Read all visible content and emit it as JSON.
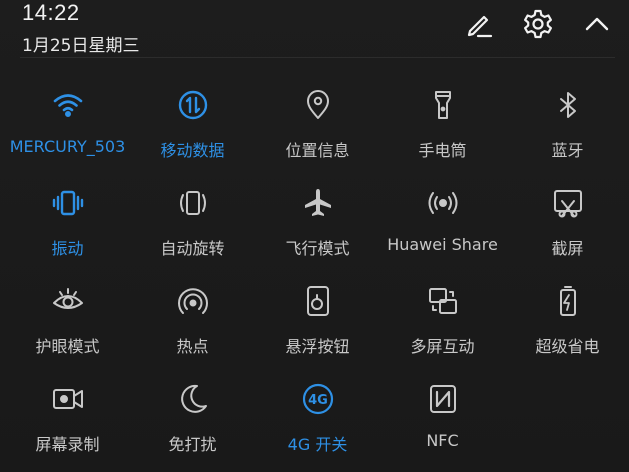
{
  "status": {
    "time": "14:22",
    "date": "1月25日星期三"
  },
  "header_actions": [
    {
      "icon": "edit-icon"
    },
    {
      "icon": "settings-icon"
    },
    {
      "icon": "collapse-icon"
    }
  ],
  "colors": {
    "active": "#2e90e5",
    "inactive": "#c8c8c8",
    "background": "#1b1b1b"
  },
  "toggles": [
    {
      "label": "MERCURY_503",
      "icon": "wifi-icon",
      "active": true
    },
    {
      "label": "移动数据",
      "icon": "mobile-data-icon",
      "active": true
    },
    {
      "label": "位置信息",
      "icon": "location-icon",
      "active": false
    },
    {
      "label": "手电筒",
      "icon": "flashlight-icon",
      "active": false
    },
    {
      "label": "蓝牙",
      "icon": "bluetooth-icon",
      "active": false
    },
    {
      "label": "振动",
      "icon": "vibrate-icon",
      "active": true
    },
    {
      "label": "自动旋转",
      "icon": "auto-rotate-icon",
      "active": false
    },
    {
      "label": "飞行模式",
      "icon": "airplane-icon",
      "active": false
    },
    {
      "label": "Huawei Share",
      "icon": "huawei-share-icon",
      "active": false
    },
    {
      "label": "截屏",
      "icon": "screenshot-icon",
      "active": false
    },
    {
      "label": "护眼模式",
      "icon": "eye-comfort-icon",
      "active": false
    },
    {
      "label": "热点",
      "icon": "hotspot-icon",
      "active": false
    },
    {
      "label": "悬浮按钮",
      "icon": "floating-button-icon",
      "active": false
    },
    {
      "label": "多屏互动",
      "icon": "multi-screen-icon",
      "active": false
    },
    {
      "label": "超级省电",
      "icon": "ultra-power-saving-icon",
      "active": false
    },
    {
      "label": "屏幕录制",
      "icon": "screen-record-icon",
      "active": false
    },
    {
      "label": "免打扰",
      "icon": "do-not-disturb-icon",
      "active": false
    },
    {
      "label": "4G 开关",
      "icon": "4g-icon",
      "active": true
    },
    {
      "label": "NFC",
      "icon": "nfc-icon",
      "active": false
    }
  ]
}
